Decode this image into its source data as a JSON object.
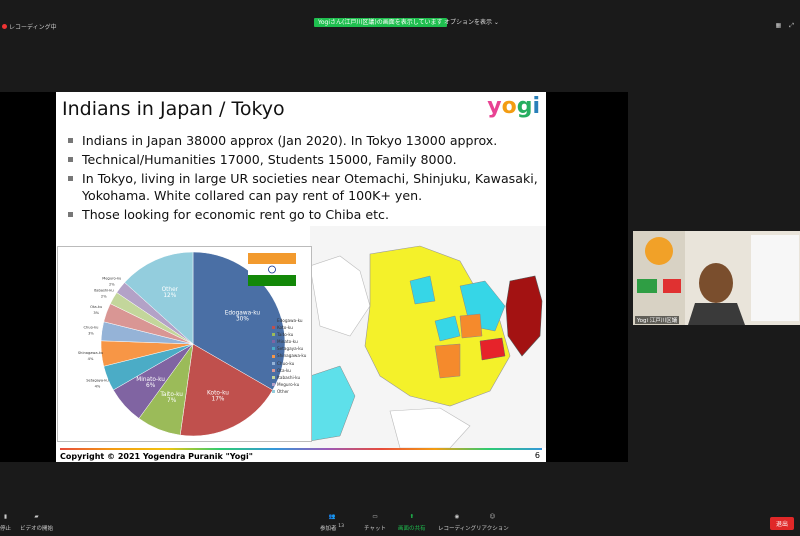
{
  "window": {
    "recording": "レコーディング中",
    "share_banner": "Yogiさん(江戸川区議)の画面を表示しています",
    "view_options": "オプションを表示 ⌄"
  },
  "slide": {
    "title": "Indians in Japan / Tokyo",
    "logo": [
      "y",
      "o",
      "g",
      "i"
    ],
    "bullets": [
      "Indians in Japan 38000 approx (Jan 2020). In Tokyo 13000 approx.",
      "Technical/Humanities 17000, Students 15000, Family 8000.",
      "In Tokyo, living in large UR societies near Otemachi, Shinjuku, Kawasaki, Yokohama. White collared can pay rent of 100K+ yen.",
      "Those looking for economic rent go to Chiba etc."
    ],
    "copyright": "Copyright © 2021 Yogendra Puranik \"Yogi\"",
    "page": "6"
  },
  "chart_data": {
    "type": "pie",
    "slices": [
      {
        "name": "Edogawa-ku",
        "value": 30,
        "color": "#4a6fa5"
      },
      {
        "name": "Koto-ku",
        "value": 17,
        "color": "#c0504d"
      },
      {
        "name": "Taito-ku",
        "value": 7,
        "color": "#9bbb59"
      },
      {
        "name": "Minato-ku",
        "value": 6,
        "color": "#8064a2"
      },
      {
        "name": "Setagaya-ku",
        "value": 4,
        "color": "#4bacc6"
      },
      {
        "name": "Shinagawa-ku",
        "value": 4,
        "color": "#f79646"
      },
      {
        "name": "Chuo-ku",
        "value": 3,
        "color": "#95b3d7"
      },
      {
        "name": "Ota-ku",
        "value": 3,
        "color": "#d99694"
      },
      {
        "name": "Itabashi-ku",
        "value": 2,
        "color": "#c3d69b"
      },
      {
        "name": "Meguro-ku",
        "value": 2,
        "color": "#b3a2c7"
      },
      {
        "name": "Other",
        "value": 12,
        "color": "#93cddd"
      }
    ],
    "labels": [
      {
        "text": "Edogawa-ku",
        "pct": "30%"
      },
      {
        "text": "Koto-ku",
        "pct": "17%"
      },
      {
        "text": "Taito-ku",
        "pct": "7%"
      },
      {
        "text": "Minato-ku",
        "pct": "6%"
      },
      {
        "text": "Setagaya-ku",
        "pct": "4%"
      },
      {
        "text": "Shinagawa-ku",
        "pct": "4%"
      },
      {
        "text": "Chuo-ku",
        "pct": "3%"
      },
      {
        "text": "Ota-ku",
        "pct": "3%"
      },
      {
        "text": "Itabashi-ku",
        "pct": "2%"
      },
      {
        "text": "Meguro-ku",
        "pct": "2%"
      },
      {
        "text": "Other",
        "pct": "12%"
      }
    ],
    "legend": [
      "Edogawa-ku",
      "Koto-ku",
      "Taito-ku",
      "Minato-ku",
      "Setagaya-ku",
      "Shinagawa-ku",
      "Chuo-ku",
      "Ota-ku",
      "Itabashi-ku",
      "Meguro-ku",
      "Other"
    ]
  },
  "video": {
    "name_label": "Yogi 江戸川区議"
  },
  "toolbar": {
    "items": [
      "停止",
      "ビデオの開始",
      "参加者",
      "チャット",
      "画面の共有",
      "レコーディング",
      "リアクション"
    ],
    "participants_count": "13",
    "end_label": "退出"
  }
}
